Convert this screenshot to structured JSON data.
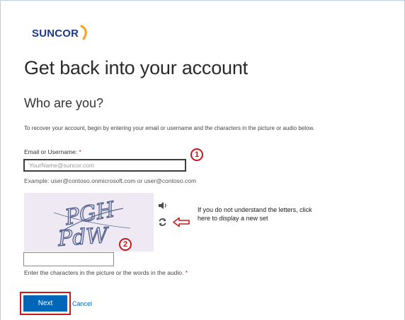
{
  "brand": {
    "logo_text": "SUNCOR",
    "text_color": "#1d3a8a",
    "arc_color": "#f5a11c"
  },
  "page": {
    "title": "Get back into your account",
    "subtitle": "Who are you?",
    "instructions": "To recover your account, begin by entering your email or username and the characters in the picture or audio below."
  },
  "email": {
    "label": "Email or Username:",
    "required_mark": "*",
    "placeholder": "YourName@suncor.com",
    "value": "",
    "example": "Example: user@contoso.onmicrosoft.com or user@contoso.com"
  },
  "captcha": {
    "image_text": [
      "PGH",
      "PdW"
    ],
    "audio_icon": "speaker-icon",
    "refresh_icon": "refresh-icon",
    "input_value": "",
    "label": "Enter the characters in the picture or the words in the audio.",
    "required_mark": "*"
  },
  "annotations": {
    "marker_1": "1",
    "marker_2": "2",
    "tip": "If you do not understand  the letters, click here to display a new set",
    "arrow_icon": "left-arrow-icon",
    "highlight_color": "#c8181e"
  },
  "actions": {
    "next_label": "Next",
    "cancel_label": "Cancel",
    "primary_color": "#0067b8"
  }
}
